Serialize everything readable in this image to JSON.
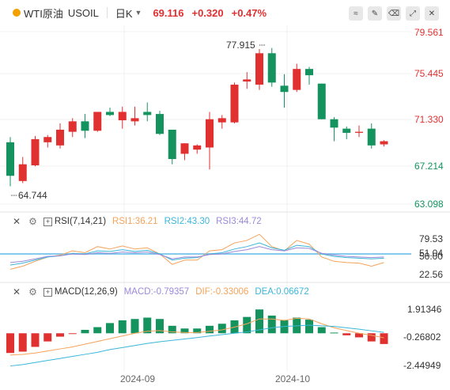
{
  "header": {
    "symbol_name": "WTI原油",
    "symbol_code": "USOIL",
    "period": "日K",
    "last_price": "69.116",
    "change": "+0.320",
    "change_pct": "+0.47%",
    "icons": [
      "line-style-icon",
      "draw-icon",
      "erase-icon",
      "expand-icon",
      "close-icon"
    ]
  },
  "colors": {
    "up": "#e03030",
    "down": "#14935f",
    "rsi1": "#f5a35a",
    "rsi2": "#3bb6d8",
    "rsi3": "#9b8ad8",
    "dif": "#f5a35a",
    "dea": "#3bb6d8",
    "ref_line": "#5fb8e8"
  },
  "price_axis": {
    "ticks": [
      "79.561",
      "75.445",
      "71.330",
      "67.214",
      "63.098"
    ]
  },
  "annotations": {
    "high": "77.915",
    "low": "64.744"
  },
  "x_axis": {
    "labels": [
      "2024-09",
      "2024-10"
    ]
  },
  "rsi": {
    "title": "RSI(7,14,21)",
    "values": [
      "RSI1:36.21",
      "RSI2:43.30",
      "RSI3:44.72"
    ],
    "ticks": [
      "79.53",
      "51.04",
      "50.00",
      "22.56"
    ]
  },
  "macd": {
    "title": "MACD(12,26,9)",
    "values": [
      "MACD:-0.79357",
      "DIF:-0.33006",
      "DEA:0.06672"
    ],
    "ticks": [
      "1.91346",
      "-0.26802",
      "-2.44949"
    ]
  },
  "chart_data": [
    {
      "type": "candlestick",
      "title": "",
      "ylim": [
        63.098,
        79.561
      ],
      "candles": [
        {
          "o": 69.0,
          "h": 69.5,
          "l": 64.8,
          "c": 65.8
        },
        {
          "o": 65.3,
          "h": 67.6,
          "l": 65.1,
          "c": 66.9
        },
        {
          "o": 66.8,
          "h": 69.6,
          "l": 66.7,
          "c": 69.3
        },
        {
          "o": 69.0,
          "h": 69.7,
          "l": 68.5,
          "c": 69.5
        },
        {
          "o": 68.7,
          "h": 70.8,
          "l": 68.4,
          "c": 70.2
        },
        {
          "o": 70.0,
          "h": 71.3,
          "l": 69.5,
          "c": 71.0
        },
        {
          "o": 71.0,
          "h": 71.7,
          "l": 69.4,
          "c": 70.1
        },
        {
          "o": 70.1,
          "h": 71.9,
          "l": 70.0,
          "c": 71.9
        },
        {
          "o": 71.9,
          "h": 72.3,
          "l": 71.5,
          "c": 71.6
        },
        {
          "o": 71.1,
          "h": 72.4,
          "l": 70.3,
          "c": 71.9
        },
        {
          "o": 71.0,
          "h": 72.4,
          "l": 70.6,
          "c": 71.3
        },
        {
          "o": 71.9,
          "h": 72.8,
          "l": 71.0,
          "c": 71.6
        },
        {
          "o": 71.7,
          "h": 72.0,
          "l": 69.7,
          "c": 69.8
        },
        {
          "o": 70.2,
          "h": 70.2,
          "l": 66.9,
          "c": 67.4
        },
        {
          "o": 67.9,
          "h": 68.9,
          "l": 67.3,
          "c": 68.9
        },
        {
          "o": 68.3,
          "h": 68.8,
          "l": 67.9,
          "c": 68.7
        },
        {
          "o": 68.5,
          "h": 71.9,
          "l": 66.4,
          "c": 71.2
        },
        {
          "o": 70.9,
          "h": 71.6,
          "l": 70.3,
          "c": 71.3
        },
        {
          "o": 70.9,
          "h": 74.7,
          "l": 70.8,
          "c": 74.5
        },
        {
          "o": 74.8,
          "h": 75.7,
          "l": 74.1,
          "c": 75.0
        },
        {
          "o": 74.5,
          "h": 77.9,
          "l": 74.0,
          "c": 77.5
        },
        {
          "o": 77.5,
          "h": 78.0,
          "l": 74.3,
          "c": 74.7
        },
        {
          "o": 74.4,
          "h": 75.5,
          "l": 72.3,
          "c": 73.8
        },
        {
          "o": 74.0,
          "h": 76.5,
          "l": 73.8,
          "c": 76.0
        },
        {
          "o": 76.0,
          "h": 76.2,
          "l": 74.5,
          "c": 75.4
        },
        {
          "o": 74.6,
          "h": 74.6,
          "l": 71.2,
          "c": 71.2
        },
        {
          "o": 71.2,
          "h": 71.4,
          "l": 69.1,
          "c": 70.4
        },
        {
          "o": 70.3,
          "h": 70.5,
          "l": 69.3,
          "c": 69.9
        },
        {
          "o": 69.9,
          "h": 70.6,
          "l": 69.5,
          "c": 70.0
        },
        {
          "o": 70.3,
          "h": 70.8,
          "l": 68.4,
          "c": 68.7
        },
        {
          "o": 68.8,
          "h": 69.2,
          "l": 68.6,
          "c": 69.1
        }
      ]
    },
    {
      "type": "line",
      "title": "RSI(7,14,21)",
      "ylim": [
        10,
        90
      ],
      "series": [
        {
          "name": "RSI1",
          "values": [
            25,
            30,
            38,
            45,
            48,
            55,
            52,
            62,
            58,
            63,
            58,
            60,
            50,
            33,
            40,
            40,
            55,
            57,
            68,
            72,
            82,
            62,
            55,
            72,
            66,
            45,
            38,
            36,
            35,
            30,
            36
          ]
        },
        {
          "name": "RSI2",
          "values": [
            32,
            35,
            40,
            45,
            47,
            51,
            50,
            55,
            54,
            57,
            54,
            56,
            50,
            40,
            43,
            44,
            50,
            52,
            58,
            62,
            68,
            60,
            56,
            64,
            62,
            50,
            46,
            44,
            43,
            42,
            43
          ]
        },
        {
          "name": "RSI3",
          "values": [
            36,
            38,
            42,
            46,
            47,
            50,
            49,
            52,
            51,
            53,
            52,
            53,
            49,
            42,
            45,
            45,
            49,
            50,
            54,
            57,
            62,
            57,
            55,
            60,
            59,
            51,
            48,
            46,
            45,
            44,
            45
          ]
        }
      ]
    },
    {
      "type": "bar",
      "title": "MACD(12,26,9)",
      "ylim": [
        -2.6,
        2.4
      ],
      "macd": [
        -1.45,
        -1.35,
        -1.0,
        -0.6,
        -0.25,
        -0.05,
        0.25,
        0.45,
        0.75,
        0.95,
        1.05,
        1.15,
        1.05,
        0.55,
        0.35,
        0.35,
        0.55,
        0.7,
        0.95,
        1.2,
        1.75,
        1.3,
        0.95,
        1.15,
        1.0,
        0.45,
        0.05,
        -0.15,
        -0.3,
        -0.6,
        -0.79
      ],
      "dif": [
        -1.6,
        -1.55,
        -1.45,
        -1.3,
        -1.15,
        -1.0,
        -0.8,
        -0.6,
        -0.4,
        -0.2,
        0.0,
        0.15,
        0.2,
        0.1,
        0.05,
        0.05,
        0.15,
        0.25,
        0.45,
        0.7,
        1.05,
        1.05,
        0.95,
        1.1,
        1.05,
        0.7,
        0.4,
        0.2,
        0.0,
        -0.15,
        -0.33
      ],
      "dea": [
        -2.4,
        -2.3,
        -2.15,
        -2.0,
        -1.85,
        -1.7,
        -1.55,
        -1.4,
        -1.2,
        -1.05,
        -0.9,
        -0.75,
        -0.62,
        -0.52,
        -0.42,
        -0.32,
        -0.2,
        -0.1,
        0.0,
        0.1,
        0.25,
        0.4,
        0.5,
        0.55,
        0.6,
        0.55,
        0.5,
        0.4,
        0.3,
        0.18,
        0.07
      ]
    }
  ]
}
